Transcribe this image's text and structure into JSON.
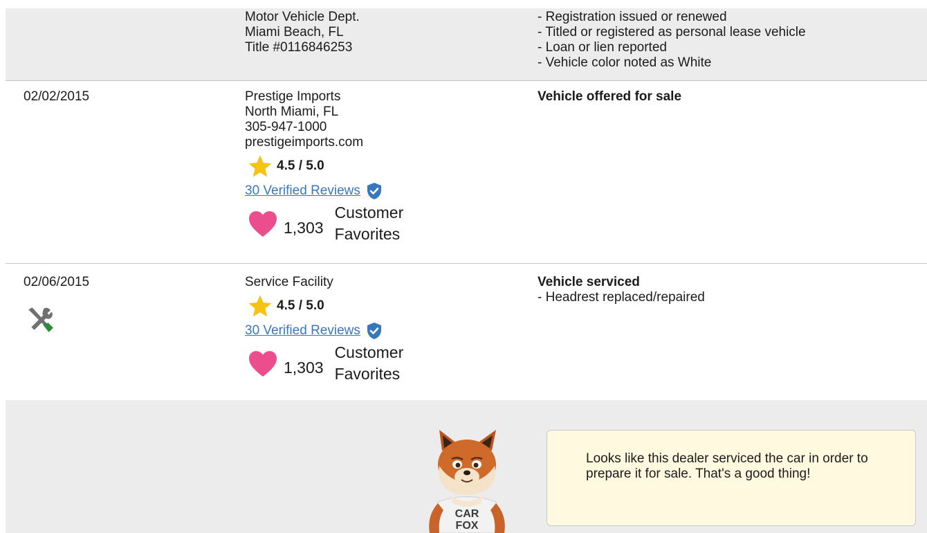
{
  "records": [
    {
      "date": "",
      "source_lines": [
        "Motor Vehicle Dept.",
        "Miami Beach, FL",
        "Title #0116846253"
      ],
      "comment_title": "",
      "comment_lines": [
        "- Registration issued or renewed",
        "- Titled or registered as personal lease vehicle",
        "- Loan or lien reported",
        "- Vehicle color noted as White"
      ]
    },
    {
      "date": "02/02/2015",
      "source_lines": [
        "Prestige Imports",
        "North Miami, FL",
        "305-947-1000",
        "prestigeimports.com"
      ],
      "rating": "4.5 / 5.0",
      "reviews_link": "30 Verified Reviews",
      "favorites_count": "1,303",
      "favorites_label_1": "Customer",
      "favorites_label_2": "Favorites",
      "comment_title": "Vehicle offered for sale",
      "comment_lines": []
    },
    {
      "date": "02/06/2015",
      "source_lines": [
        "Service Facility"
      ],
      "rating": "4.5 / 5.0",
      "reviews_link": "30 Verified Reviews",
      "favorites_count": "1,303",
      "favorites_label_1": "Customer",
      "favorites_label_2": "Favorites",
      "comment_title": "Vehicle serviced",
      "comment_lines": [
        "- Headrest replaced/repaired"
      ]
    }
  ],
  "tip": {
    "text": "Looks like this dealer serviced the car in order to prepare it for sale. That's a good thing!",
    "mascot_shirt_line1": "CAR",
    "mascot_shirt_line2": "FOX"
  },
  "icons": {
    "rating": "star-icon",
    "verified": "verified-shield-icon",
    "favorites": "heart-icon",
    "service": "service-tools-icon",
    "mascot": "carfox-mascot"
  },
  "colors": {
    "star": "#f5c313",
    "link": "#3777bc",
    "shield": "#3777bc",
    "heart": "#ec4d8c",
    "tip_bg": "#fff9df",
    "row_alt_bg": "#ececec"
  }
}
